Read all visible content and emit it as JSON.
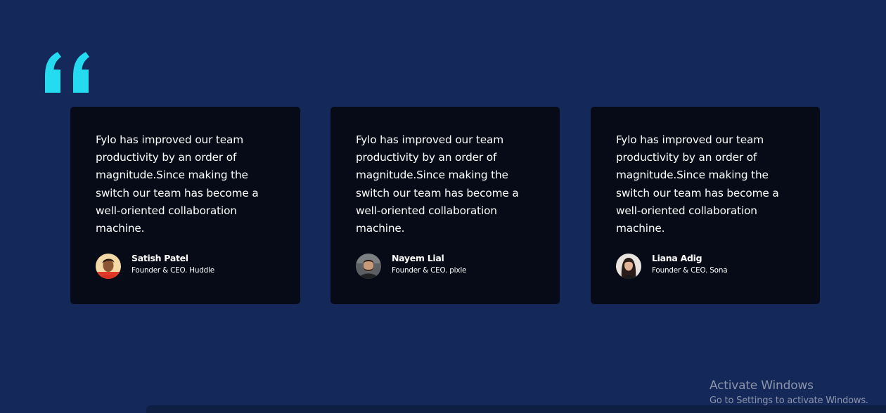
{
  "section": {
    "background_color": "#15285a",
    "quote_icon": "left-double-quote-icon",
    "quote_icon_color": "#25dbf0"
  },
  "testimonials": [
    {
      "text": "Fylo has improved our team productivity by an order of magnitude.Since making the switch our team has become a well-oriented collaboration machine.",
      "name": "Satish Patel",
      "role": "Founder & CEO. Huddle"
    },
    {
      "text": "Fylo has improved our team productivity by an order of magnitude.Since making the switch our team has become a well-oriented collaboration machine.",
      "name": "Nayem Lial",
      "role": "Founder & CEO. pixle"
    },
    {
      "text": "Fylo has improved our team productivity by an order of magnitude.Since making the switch our team has become a well-oriented collaboration machine.",
      "name": "Liana Adig",
      "role": "Founder & CEO. Sona"
    }
  ],
  "card_color": "#060b17",
  "watermark": {
    "title": "Activate Windows",
    "subtitle": "Go to Settings to activate Windows."
  }
}
